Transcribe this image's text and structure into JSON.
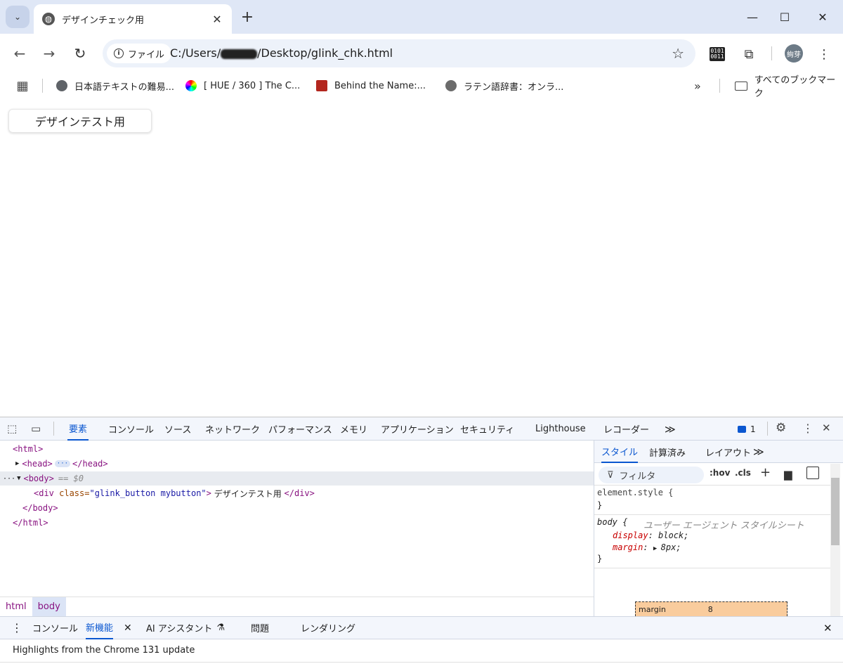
{
  "browser": {
    "tab_title": "デザインチェック用",
    "close_glyph": "✕",
    "new_tab_glyph": "+",
    "window": {
      "minimize": "—",
      "maximize": "☐",
      "close": "✕"
    }
  },
  "toolbar": {
    "back": "←",
    "forward": "→",
    "reload": "↻",
    "chip_label": "ファイル",
    "url_prefix": "C:/Users/",
    "url_suffix": "/Desktop/glink_chk.html",
    "star": "☆",
    "binary_top": "0101",
    "binary_bottom": "0011",
    "extension": "⧉",
    "avatar": "絢芽",
    "menu": "⋮"
  },
  "bookmarks": {
    "apps": "▦",
    "items": [
      {
        "label": "日本語テキストの難易..."
      },
      {
        "label": "[ HUE / 360 ] The C..."
      },
      {
        "label": "Behind the Name:..."
      },
      {
        "label": "ラテン語辞書：オンラ..."
      }
    ],
    "overflow": "»",
    "all_bookmarks": "すべてのブックマーク"
  },
  "page": {
    "button_label": "デザインテスト用"
  },
  "devtools": {
    "tabs": [
      "要素",
      "コンソール",
      "ソース",
      "ネットワーク",
      "パフォーマンス",
      "メモリ",
      "アプリケーション",
      "セキュリティ",
      "Lighthouse",
      "レコーダー"
    ],
    "overflow": "≫",
    "issues_count": "1",
    "elements": {
      "html_open": "<html>",
      "head": "<head>",
      "head_close": "</head>",
      "body_open": "<body>",
      "body_marker": "== $0",
      "div_open": "<div ",
      "div_attr": "class=",
      "div_val": "\"glink_button mybutton\"",
      "div_gt": ">",
      "div_text": " デザインテスト用 ",
      "div_close": "</div>",
      "body_close": "</body>",
      "html_close": "</html>"
    },
    "breadcrumbs": [
      "html",
      "body"
    ],
    "styles": {
      "tabs": [
        "スタイル",
        "計算済み",
        "レイアウト"
      ],
      "overflow": "≫",
      "filter_placeholder": "フィルタ",
      "hov": ":hov",
      "cls": ".cls",
      "plus": "+",
      "element_style": "element.style {",
      "close_brace": "}",
      "body_selector": "body {",
      "ua_note": "ユーザー エージェント スタイルシート",
      "prop1_name": "display",
      "prop1_value": "block;",
      "prop2_name": "margin",
      "prop2_value": "8px;",
      "box_label": "margin",
      "box_value": "8"
    },
    "drawer": {
      "tabs": [
        "コンソール",
        "新機能",
        "AI アシスタント",
        "問題",
        "レンダリング"
      ],
      "body_text": "Highlights from the Chrome 131 update"
    }
  }
}
